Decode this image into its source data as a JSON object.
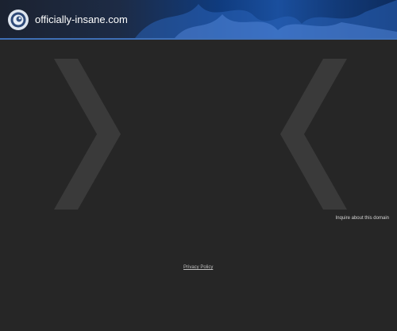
{
  "header": {
    "site_name": "officially-insane.com",
    "logo_icon": "swirl-logo-icon"
  },
  "main": {
    "inquire_link": "Inquire about this domain",
    "privacy_link": "Privacy Policy"
  },
  "colors": {
    "background": "#262626",
    "header_accent": "#3e6fb6",
    "chevron": "#3a3a3a"
  }
}
